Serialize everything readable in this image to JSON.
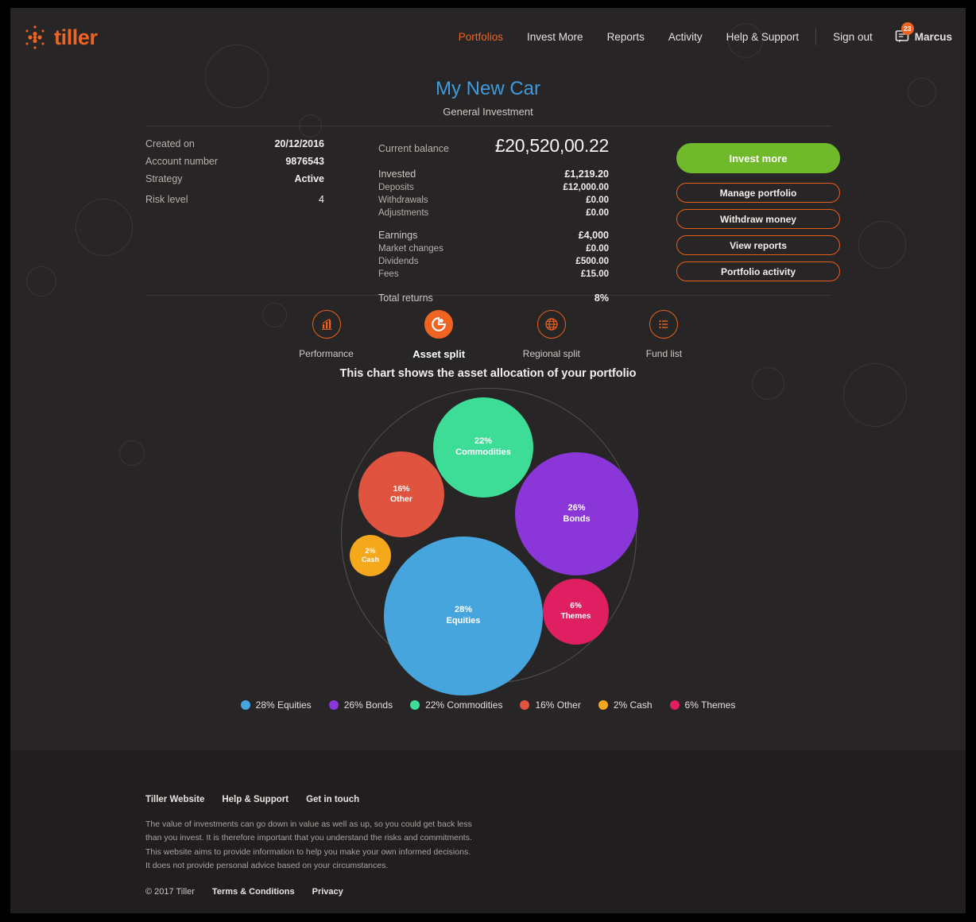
{
  "brand": {
    "name": "tiller",
    "color": "#ef6423"
  },
  "nav": {
    "links": [
      {
        "label": "Portfolios",
        "active": true
      },
      {
        "label": "Invest More",
        "active": false
      },
      {
        "label": "Reports",
        "active": false
      },
      {
        "label": "Activity",
        "active": false
      },
      {
        "label": "Help & Support",
        "active": false
      }
    ],
    "sign_out": "Sign out",
    "messages_icon": "message-icon",
    "messages_badge": "23",
    "user": "Marcus"
  },
  "header": {
    "title": "My New Car",
    "subtitle": "General Investment",
    "title_color": "#3e9bdd"
  },
  "facts": [
    {
      "key": "Created on",
      "value": "20/12/2016"
    },
    {
      "key": "Account number",
      "value": "9876543"
    },
    {
      "key": "Strategy",
      "value": "Active"
    },
    {
      "key": "Risk level",
      "value": "4"
    }
  ],
  "balance": {
    "label": "Current balance",
    "value": "£20,520,00.22",
    "lines": [
      {
        "key": "Invested",
        "value": "£1,219.20",
        "group": "head"
      },
      {
        "key": "Deposits",
        "value": "£12,000.00",
        "group": "item"
      },
      {
        "key": "Withdrawals",
        "value": "£0.00",
        "group": "item"
      },
      {
        "key": "Adjustments",
        "value": "£0.00",
        "group": "item"
      },
      {
        "key": "Earnings",
        "value": "£4,000",
        "group": "head"
      },
      {
        "key": "Market changes",
        "value": "£0.00",
        "group": "item"
      },
      {
        "key": "Dividends",
        "value": "£500.00",
        "group": "item"
      },
      {
        "key": "Fees",
        "value": "£15.00",
        "group": "item"
      },
      {
        "key": "Total returns",
        "value": "8%",
        "group": "total"
      }
    ]
  },
  "actions": {
    "primary": {
      "label": "Invest more",
      "color": "#6fb92a"
    },
    "secondary": [
      {
        "label": "Manage portfolio"
      },
      {
        "label": "Withdraw money"
      },
      {
        "label": "View reports"
      },
      {
        "label": "Portfolio activity"
      }
    ],
    "outline_color": "#e8601c"
  },
  "tabs": [
    {
      "label": "Performance",
      "icon": "bar-chart-icon",
      "active": false
    },
    {
      "label": "Asset split",
      "icon": "donut-chart-icon",
      "active": true
    },
    {
      "label": "Regional split",
      "icon": "globe-icon",
      "active": false
    },
    {
      "label": "Fund list",
      "icon": "list-icon",
      "active": false
    }
  ],
  "chart_data": {
    "type": "pie",
    "title": "This chart shows the asset allocation of your portfolio",
    "legend_position": "bottom",
    "categories": [
      "Equities",
      "Bonds",
      "Commodities",
      "Other",
      "Cash",
      "Themes"
    ],
    "values": [
      28,
      26,
      22,
      16,
      2,
      6
    ],
    "unit": "%",
    "colors": [
      "#46a5dd",
      "#8b36d9",
      "#3ddc97",
      "#e0543f",
      "#f5a81c",
      "#e01e62"
    ],
    "labels": [
      {
        "name": "Equities",
        "value": 28,
        "text": "28%",
        "color": "#46a5dd"
      },
      {
        "name": "Bonds",
        "value": 26,
        "text": "26%",
        "color": "#8b36d9"
      },
      {
        "name": "Commodities",
        "value": 22,
        "text": "22%",
        "color": "#3ddc97"
      },
      {
        "name": "Other",
        "value": 16,
        "text": "16%",
        "color": "#e0543f"
      },
      {
        "name": "Cash",
        "value": 2,
        "text": "2%",
        "color": "#f5a81c"
      },
      {
        "name": "Themes",
        "value": 6,
        "text": "6%",
        "color": "#e01e62"
      }
    ],
    "legend": [
      "28% Equities",
      "26% Bonds",
      "22% Commodities",
      "16% Other",
      "2% Cash",
      "6% Themes"
    ]
  },
  "footer": {
    "links": [
      "Tiller Website",
      "Help & Support",
      "Get in touch"
    ],
    "disclaimer": "The value of investments can go down in value as well as up, so you could get back less than you invest. It is therefore important that you understand the risks and commitments. This website aims to provide information to help you make your own informed decisions. It does not provide personal advice based on your circumstances.",
    "copyright": "© 2017 Tiller",
    "terms": "Terms & Conditions",
    "privacy": "Privacy"
  }
}
